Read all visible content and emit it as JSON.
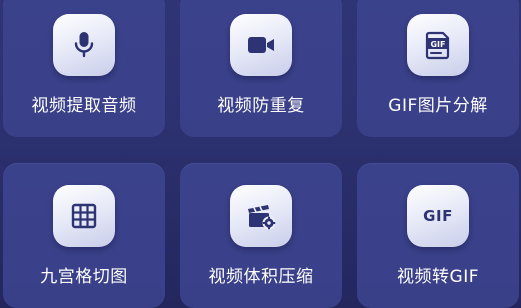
{
  "colors": {
    "background": "#2c3170",
    "card": "#3b428c",
    "icon_tile": "#eef0fa",
    "icon_fg": "#2d3373",
    "label": "#ffffff"
  },
  "tools": [
    {
      "label": "视频提取音频",
      "icon": "microphone-icon"
    },
    {
      "label": "视频防重复",
      "icon": "video-camera-icon"
    },
    {
      "label": "GIF图片分解",
      "icon": "gif-file-icon"
    },
    {
      "label": "九宫格切图",
      "icon": "grid-icon"
    },
    {
      "label": "视频体积压缩",
      "icon": "clapperboard-gear-icon"
    },
    {
      "label": "视频转GIF",
      "icon": "gif-text-icon",
      "icon_text": "GIF"
    }
  ],
  "gif_badge_text": "GIF"
}
